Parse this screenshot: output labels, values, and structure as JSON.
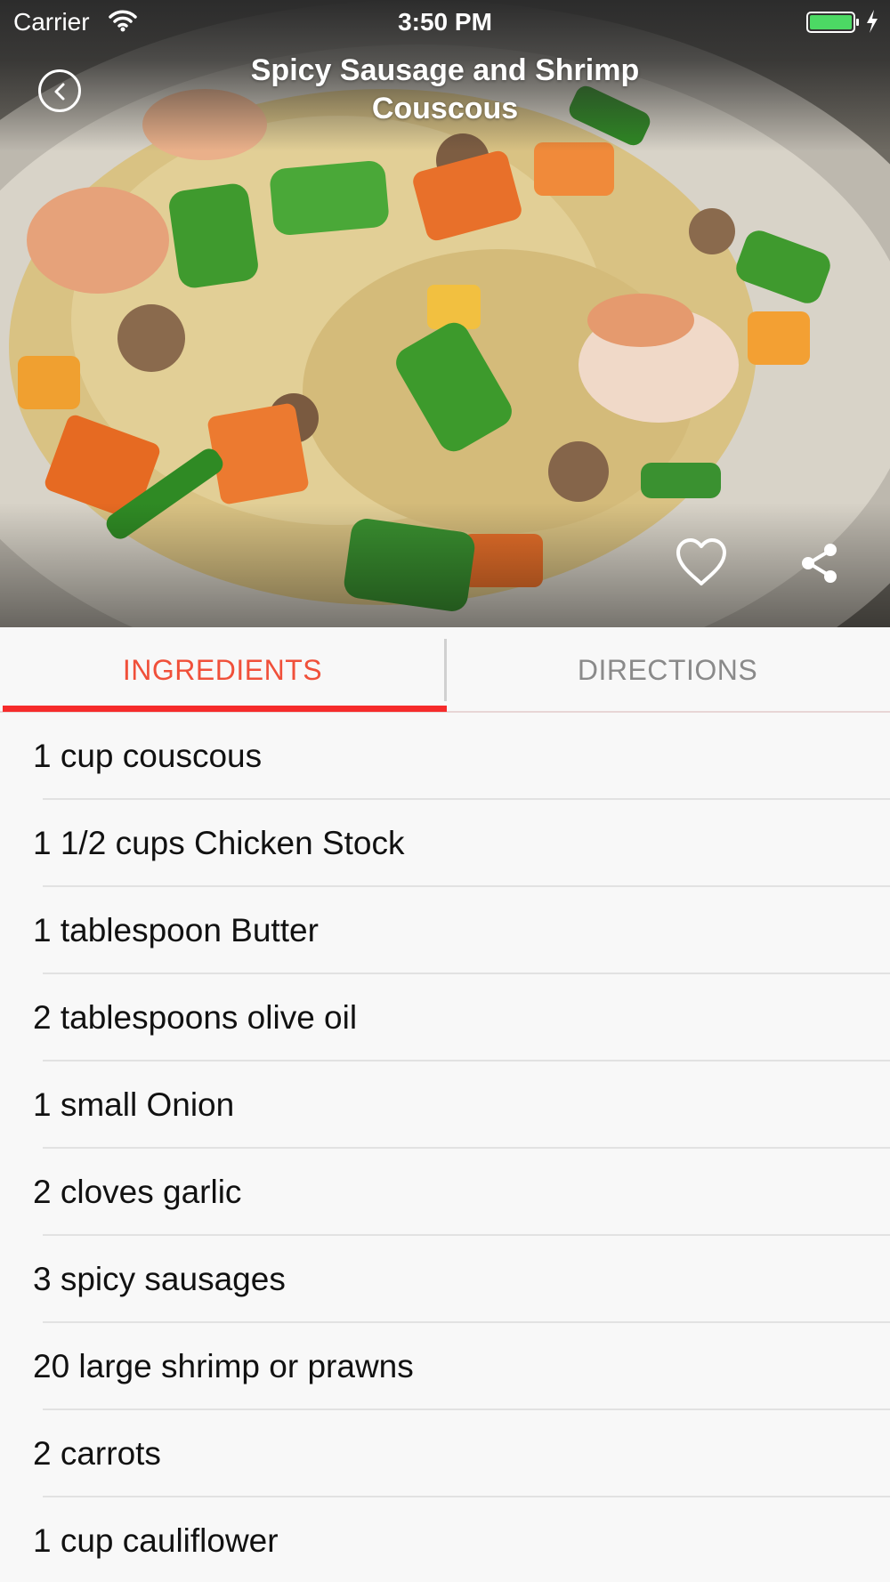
{
  "status_bar": {
    "carrier": "Carrier",
    "time": "3:50 PM",
    "battery_color": "#4cd964"
  },
  "recipe": {
    "title": "Spicy Sausage and Shrimp Couscous"
  },
  "icons": {
    "back": "chevron-left-circle-icon",
    "favorite": "heart-outline-icon",
    "share": "share-icon"
  },
  "tabs": [
    {
      "label": "INGREDIENTS",
      "active": true
    },
    {
      "label": "DIRECTIONS",
      "active": false
    }
  ],
  "colors": {
    "accent": "#f62b2b",
    "active_tab_text": "#f0503a",
    "inactive_tab_text": "#8a8a8a"
  },
  "ingredients": [
    "1 cup couscous",
    "1 1/2 cups Chicken Stock",
    "1 tablespoon Butter",
    "2 tablespoons olive oil",
    "1 small Onion",
    "2 cloves garlic",
    "3 spicy sausages",
    "20 large shrimp or prawns",
    "2 carrots",
    "1 cup cauliflower"
  ]
}
